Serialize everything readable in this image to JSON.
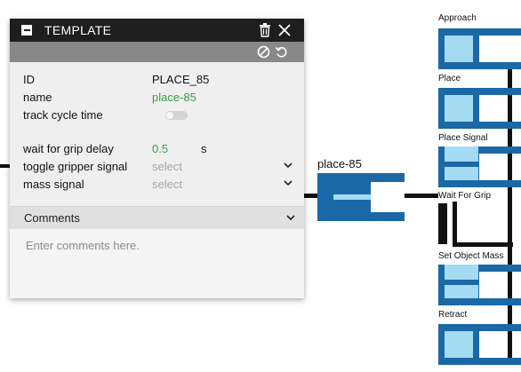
{
  "panel": {
    "title": "TEMPLATE",
    "properties": [
      {
        "label": "ID",
        "value": "PLACE_85"
      },
      {
        "label": "name",
        "value": "place-85"
      },
      {
        "label": "track cycle time",
        "value": ""
      },
      {
        "label": "wait for grip delay",
        "value": "0.5",
        "unit": "s"
      },
      {
        "label": "toggle gripper signal",
        "value": "select"
      },
      {
        "label": "mass signal",
        "value": "select"
      }
    ],
    "comments_label": "Comments",
    "comments_placeholder": "Enter comments here."
  },
  "node": {
    "label": "place-85"
  },
  "steps": [
    {
      "label": "Approach"
    },
    {
      "label": "Place"
    },
    {
      "label": "Place Signal"
    },
    {
      "label": "Wait For Grip"
    },
    {
      "label": "Set Object Mass"
    },
    {
      "label": "Retract"
    }
  ],
  "colors": {
    "node_blue": "#1a68a6",
    "node_fill": "#a4dbf3",
    "header_dark": "#1e1e1e",
    "toolbar_gray": "#888888",
    "value_green": "#3aa04a"
  }
}
